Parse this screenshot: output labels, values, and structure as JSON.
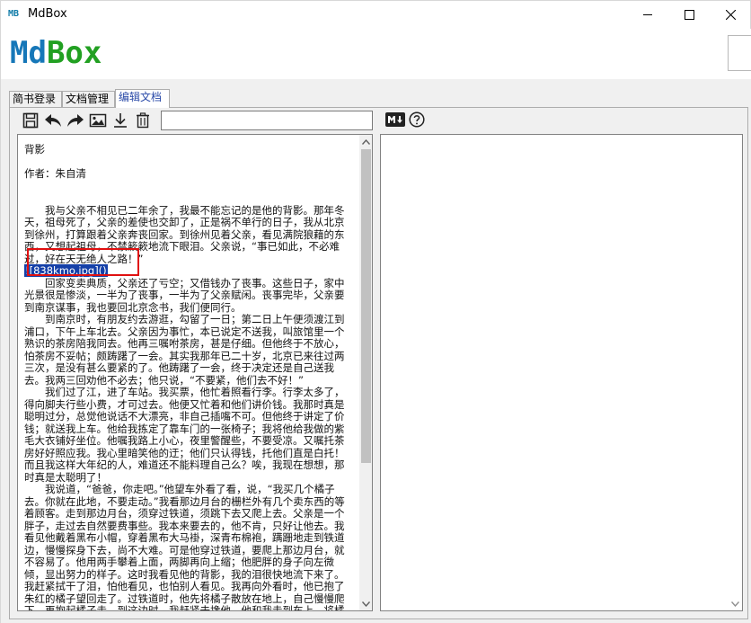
{
  "window": {
    "icon_text": "MB",
    "title": "MdBox"
  },
  "logo": {
    "part1": "Md",
    "part2": "Box"
  },
  "colors": {
    "logo_blue": "#1677b8",
    "logo_green": "#22a022",
    "selection": "#1540a8",
    "highlight_box": "#e01010",
    "active_tab_text": "#2a4aa8"
  },
  "tabs": [
    {
      "label": "简书登录",
      "active": false
    },
    {
      "label": "文档管理",
      "active": false
    },
    {
      "label": "编辑文档",
      "active": true
    }
  ],
  "toolbar": {
    "icons": [
      "save-icon",
      "undo-icon",
      "redo-icon",
      "image-icon",
      "download-icon",
      "trash-icon"
    ],
    "title_input_value": ""
  },
  "preview_toolbar": {
    "icons": [
      "markdown-icon",
      "help-icon"
    ]
  },
  "editor": {
    "lines": [
      "背影",
      "",
      "作者：朱自清",
      "",
      "",
      "　　我与父亲不相见已二年余了，我最不能忘记的是他的背影。那年冬天，祖母死了，父亲的差使也交卸了，正是祸不单行的日子，我从北京到徐州，打算跟着父亲奔丧回家。到徐州见着父亲，看见满院狼藉的东西，又想起祖母，不禁簌簌地流下眼泪。父亲说，“事已如此，不必难过，好在天无绝人之路！”"
    ],
    "selected_text": "![838kmo.jpg]()",
    "paragraphs": [
      "　　回家变卖典质，父亲还了亏空；又借钱办了丧事。这些日子，家中光景很是惨淡，一半为了丧事，一半为了父亲赋闲。丧事完毕，父亲要到南京谋事，我也要回北京念书，我们便同行。",
      "　　到南京时，有朋友约去游逛，勾留了一日；第二日上午便须渡江到浦口，下午上车北去。父亲因为事忙，本已说定不送我，叫旅馆里一个熟识的茶房陪我同去。他再三嘱咐茶房，甚是仔细。但他终于不放心，怕茶房不妥帖；颇踌躇了一会。其实我那年已二十岁，北京已来往过两三次，是没有甚么要紧的了。他踌躇了一会，终于决定还是自己送我去。我两三回劝他不必去；他只说，“不要紧，他们去不好！”",
      "　　我们过了江，进了车站。我买票，他忙着照看行李。行李太多了，得向脚夫行些小费，才可过去。他便又忙着和他们讲价钱。我那时真是聪明过分，总觉他说话不大漂亮，非自己插嘴不可。但他终于讲定了价钱；就送我上车。他给我拣定了靠车门的一张椅子；我将他给我做的紫毛大衣铺好坐位。他嘱我路上小心，夜里警醒些，不要受凉。又嘱托茶房好好照应我。我心里暗笑他的迂；他们只认得钱，托他们直是白托！而且我这样大年纪的人，难道还不能料理自己么？唉，我现在想想，那时真是太聪明了！",
      "　　我说道，“爸爸，你走吧。”他望车外看了看，说，“我买几个橘子去。你就在此地，不要走动。”我看那边月台的栅栏外有几个卖东西的等着顾客。走到那边月台，须穿过铁道，须跳下去又爬上去。父亲是一个胖子，走过去自然要费事些。我本来要去的，他不肯，只好让他去。我看见他戴着黑布小帽，穿着黑布大马褂，深青布棉袍，蹒跚地走到铁道边，慢慢探身下去，尚不大难。可是他穿过铁道，要爬上那边月台，就不容易了。他用两手攀着上面，两脚再向上缩；他肥胖的身子向左微倾，显出努力的样子。这时我看见他的背影，我的泪很快地流下来了。我赶紧拭干了泪，怕他看见，也怕别人看见。我再向外看时，他已抱了朱红的橘子望回走了。过铁道时，他先将橘子散放在地上，自己慢慢爬下，再抱起橘子走。到这边时，我赶紧去搀他。他和我走到车上，将橘子一股脑儿放在我的皮大衣上。于是扑扑衣上的泥土，心里很轻松似的，"
    ]
  }
}
